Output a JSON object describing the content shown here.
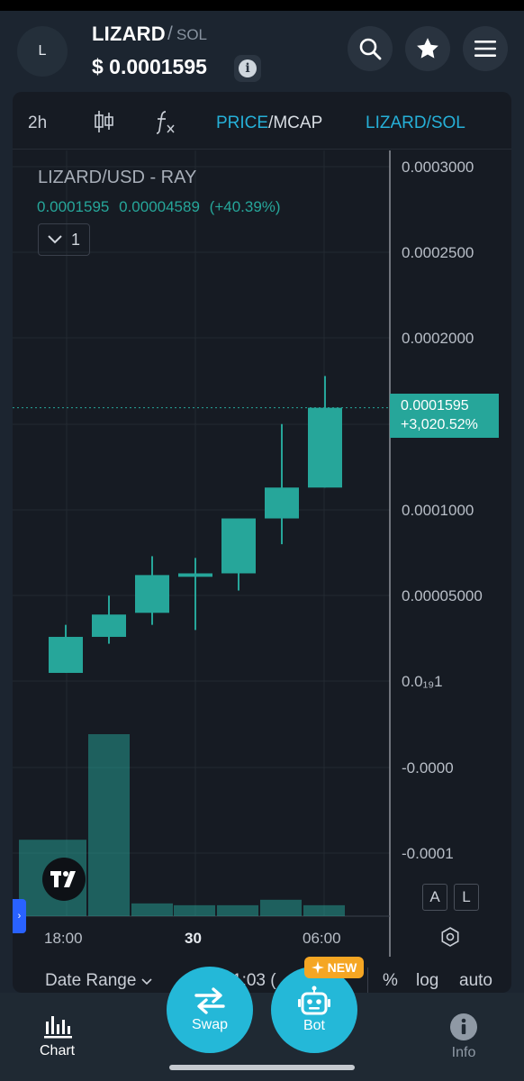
{
  "header": {
    "avatar_letter": "L",
    "token_name": "LIZARD",
    "separator": "/",
    "pair_quote": "SOL",
    "price": "$  0.0001595",
    "info_glyph": "i",
    "icons": [
      "search-icon",
      "star-icon",
      "menu-icon"
    ]
  },
  "toolbar": {
    "interval": "2h",
    "price_label": "PRICE",
    "slash": "/",
    "mcap_label": "MCAP",
    "pair_toggle": "LIZARD/SOL"
  },
  "legend": {
    "title": "LIZARD/USD - RAY",
    "last": "0.0001595",
    "change_abs": "0.00004589",
    "change_pct": "(+40.39%)",
    "toggle_count": "1"
  },
  "price_tag": {
    "value": "0.0001595",
    "change": "+3,020.52%"
  },
  "chart_buttons": {
    "auto_label_a": "A",
    "auto_label_l": "L"
  },
  "side_tab": "›",
  "bottom_row": {
    "date_range": "Date Range",
    "time_partial": "1:03 (",
    "percent": "%",
    "log": "log",
    "auto": "auto"
  },
  "nav": {
    "chart": "Chart",
    "swap": "Swap",
    "bot": "Bot",
    "info": "Info",
    "new_badge": "NEW"
  },
  "colors": {
    "up": "#26a69a",
    "accent": "#26b0d8",
    "new_badge": "#f5a623"
  },
  "chart_data": {
    "type": "candlestick",
    "y_tick_labels": [
      "0.0003000",
      "0.0002500",
      "0.0002000",
      "0.0001000",
      "0.00005000",
      "0.0₁₉1",
      "-0.0000",
      "-0.0001"
    ],
    "y_tick_values": [
      0.0003,
      0.00025,
      0.0002,
      0.0001,
      5e-05,
      0,
      -5e-05,
      -0.0001
    ],
    "x_tick_labels": [
      "18:00",
      "30",
      "06:00"
    ],
    "candles": [
      {
        "open": 5e-06,
        "high": 3.3e-05,
        "low": 5e-06,
        "close": 2.6e-05
      },
      {
        "open": 2.6e-05,
        "high": 5e-05,
        "low": 2.2e-05,
        "close": 3.9e-05
      },
      {
        "open": 4e-05,
        "high": 7.3e-05,
        "low": 3.3e-05,
        "close": 6.2e-05
      },
      {
        "open": 6.1e-05,
        "high": 7.2e-05,
        "low": 3e-05,
        "close": 6.3e-05
      },
      {
        "open": 6.3e-05,
        "high": 9.5e-05,
        "low": 5.3e-05,
        "close": 9.5e-05
      },
      {
        "open": 9.5e-05,
        "high": 0.00015,
        "low": 8e-05,
        "close": 0.000113
      },
      {
        "open": 0.000113,
        "high": 0.000178,
        "low": 0.000113,
        "close": 0.0001595
      }
    ],
    "volume": [
      0.42,
      1.0,
      0.07,
      0.06,
      0.06,
      0.09,
      0.06
    ],
    "last_price": 0.0001595
  }
}
